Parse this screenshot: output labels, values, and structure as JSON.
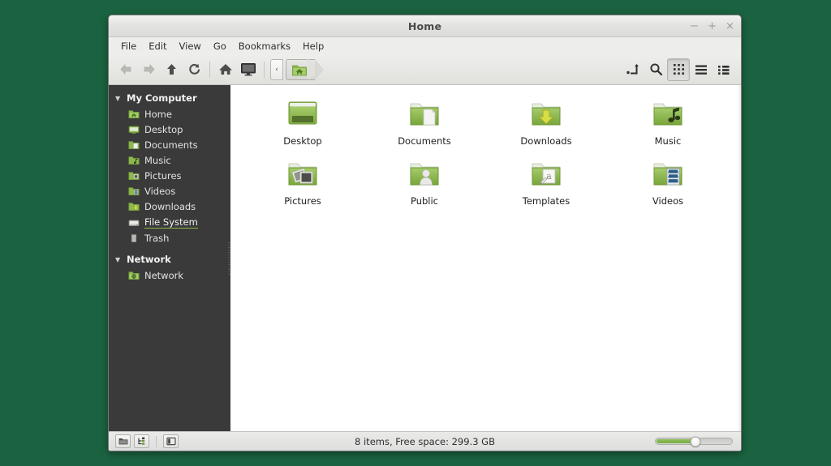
{
  "desktop": {
    "background_color": "#1b6340"
  },
  "window": {
    "title": "Home",
    "controls": {
      "minimize": "−",
      "maximize": "+",
      "close": "×"
    }
  },
  "menubar": {
    "items": [
      {
        "label": "File"
      },
      {
        "label": "Edit"
      },
      {
        "label": "View"
      },
      {
        "label": "Go"
      },
      {
        "label": "Bookmarks"
      },
      {
        "label": "Help"
      }
    ]
  },
  "toolbar": {
    "back": "back-arrow-icon",
    "forward": "forward-arrow-icon",
    "up": "up-arrow-icon",
    "reload": "reload-icon",
    "home": "home-icon",
    "computer": "computer-icon",
    "path_scroll_left": "‹",
    "path_current": "Home",
    "toggle_location": "path-entry-icon",
    "search": "search-icon",
    "view_icons": "icon-view-icon",
    "view_list": "list-view-icon",
    "view_compact": "compact-view-icon",
    "active_view": "icons"
  },
  "sidebar": {
    "groups": [
      {
        "label": "My Computer",
        "expanded": true,
        "items": [
          {
            "label": "Home",
            "icon": "home-folder-icon",
            "state": "normal"
          },
          {
            "label": "Desktop",
            "icon": "desktop-icon",
            "state": "normal"
          },
          {
            "label": "Documents",
            "icon": "documents-folder-icon",
            "state": "normal"
          },
          {
            "label": "Music",
            "icon": "music-folder-icon",
            "state": "normal"
          },
          {
            "label": "Pictures",
            "icon": "pictures-folder-icon",
            "state": "normal"
          },
          {
            "label": "Videos",
            "icon": "videos-folder-icon",
            "state": "normal"
          },
          {
            "label": "Downloads",
            "icon": "downloads-folder-icon",
            "state": "normal"
          },
          {
            "label": "File System",
            "icon": "drive-icon",
            "state": "hovered"
          },
          {
            "label": "Trash",
            "icon": "trash-icon",
            "state": "normal"
          }
        ]
      },
      {
        "label": "Network",
        "expanded": true,
        "items": [
          {
            "label": "Network",
            "icon": "network-folder-icon",
            "state": "normal"
          }
        ]
      }
    ]
  },
  "content": {
    "files": [
      {
        "label": "Desktop",
        "icon": "desktop-window-icon"
      },
      {
        "label": "Documents",
        "icon": "documents-folder-icon"
      },
      {
        "label": "Downloads",
        "icon": "downloads-folder-icon"
      },
      {
        "label": "Music",
        "icon": "music-folder-icon"
      },
      {
        "label": "Pictures",
        "icon": "pictures-folder-icon"
      },
      {
        "label": "Public",
        "icon": "public-folder-icon"
      },
      {
        "label": "Templates",
        "icon": "templates-folder-icon"
      },
      {
        "label": "Videos",
        "icon": "videos-folder-icon"
      }
    ]
  },
  "statusbar": {
    "buttons": [
      {
        "name": "icon-view-toggle",
        "icon": "folder-icon"
      },
      {
        "name": "tree-view-toggle",
        "icon": "tree-icon"
      },
      {
        "name": "sidebar-toggle",
        "icon": "panel-icon"
      }
    ],
    "status_text": "8 items, Free space: 299.3 GB",
    "zoom_percent": 52
  }
}
